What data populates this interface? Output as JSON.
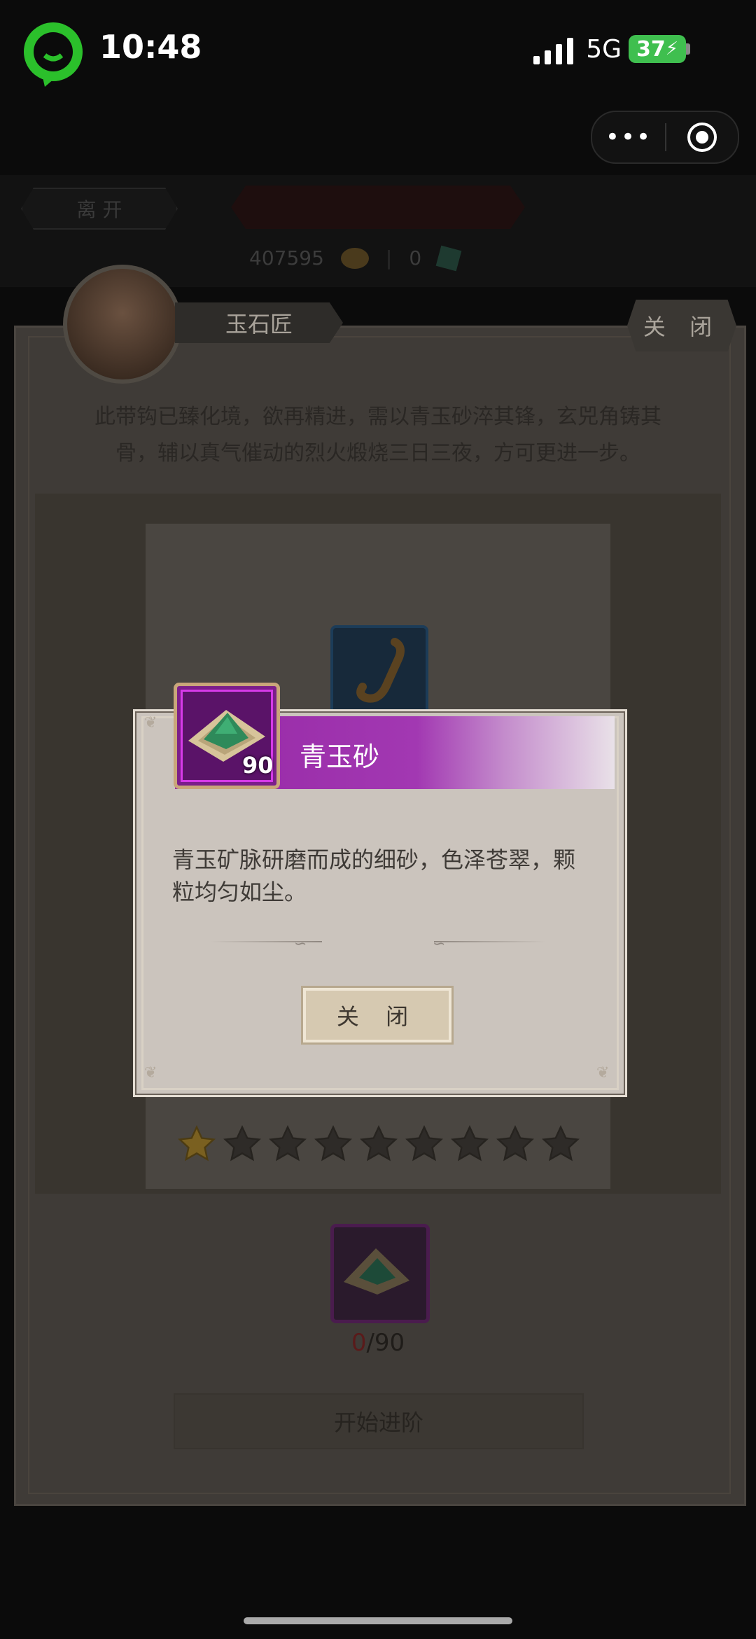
{
  "status_bar": {
    "time": "10:48",
    "network": "5G",
    "battery": "37"
  },
  "capsule": {
    "more_label": "•••",
    "icons": [
      "more-icon",
      "record-icon"
    ]
  },
  "game_header": {
    "leave_label": "离 开",
    "mid_label": "",
    "coins": "407595",
    "gems": "0"
  },
  "npc": {
    "name": "玉石匠",
    "close_label": "关 闭",
    "description": "此带钩已臻化境，欲再精进，需以青玉砂淬其锋，玄兕角铸其骨，辅以真气催动的烈火煅烧三日三夜，方可更进一步。"
  },
  "enhance": {
    "stars_filled": 1,
    "stars_total": 9,
    "material_have": "0",
    "material_need": "/90",
    "start_label": "开始进阶"
  },
  "popup": {
    "item_name": "青玉砂",
    "item_qty": "90",
    "item_desc": "青玉矿脉研磨而成的细砂，色泽苍翠，颗粒均匀如尘。",
    "close_label": "关 闭"
  },
  "colors": {
    "rarity_purple": "#9628a5",
    "star_gold": "#e0b23a"
  }
}
